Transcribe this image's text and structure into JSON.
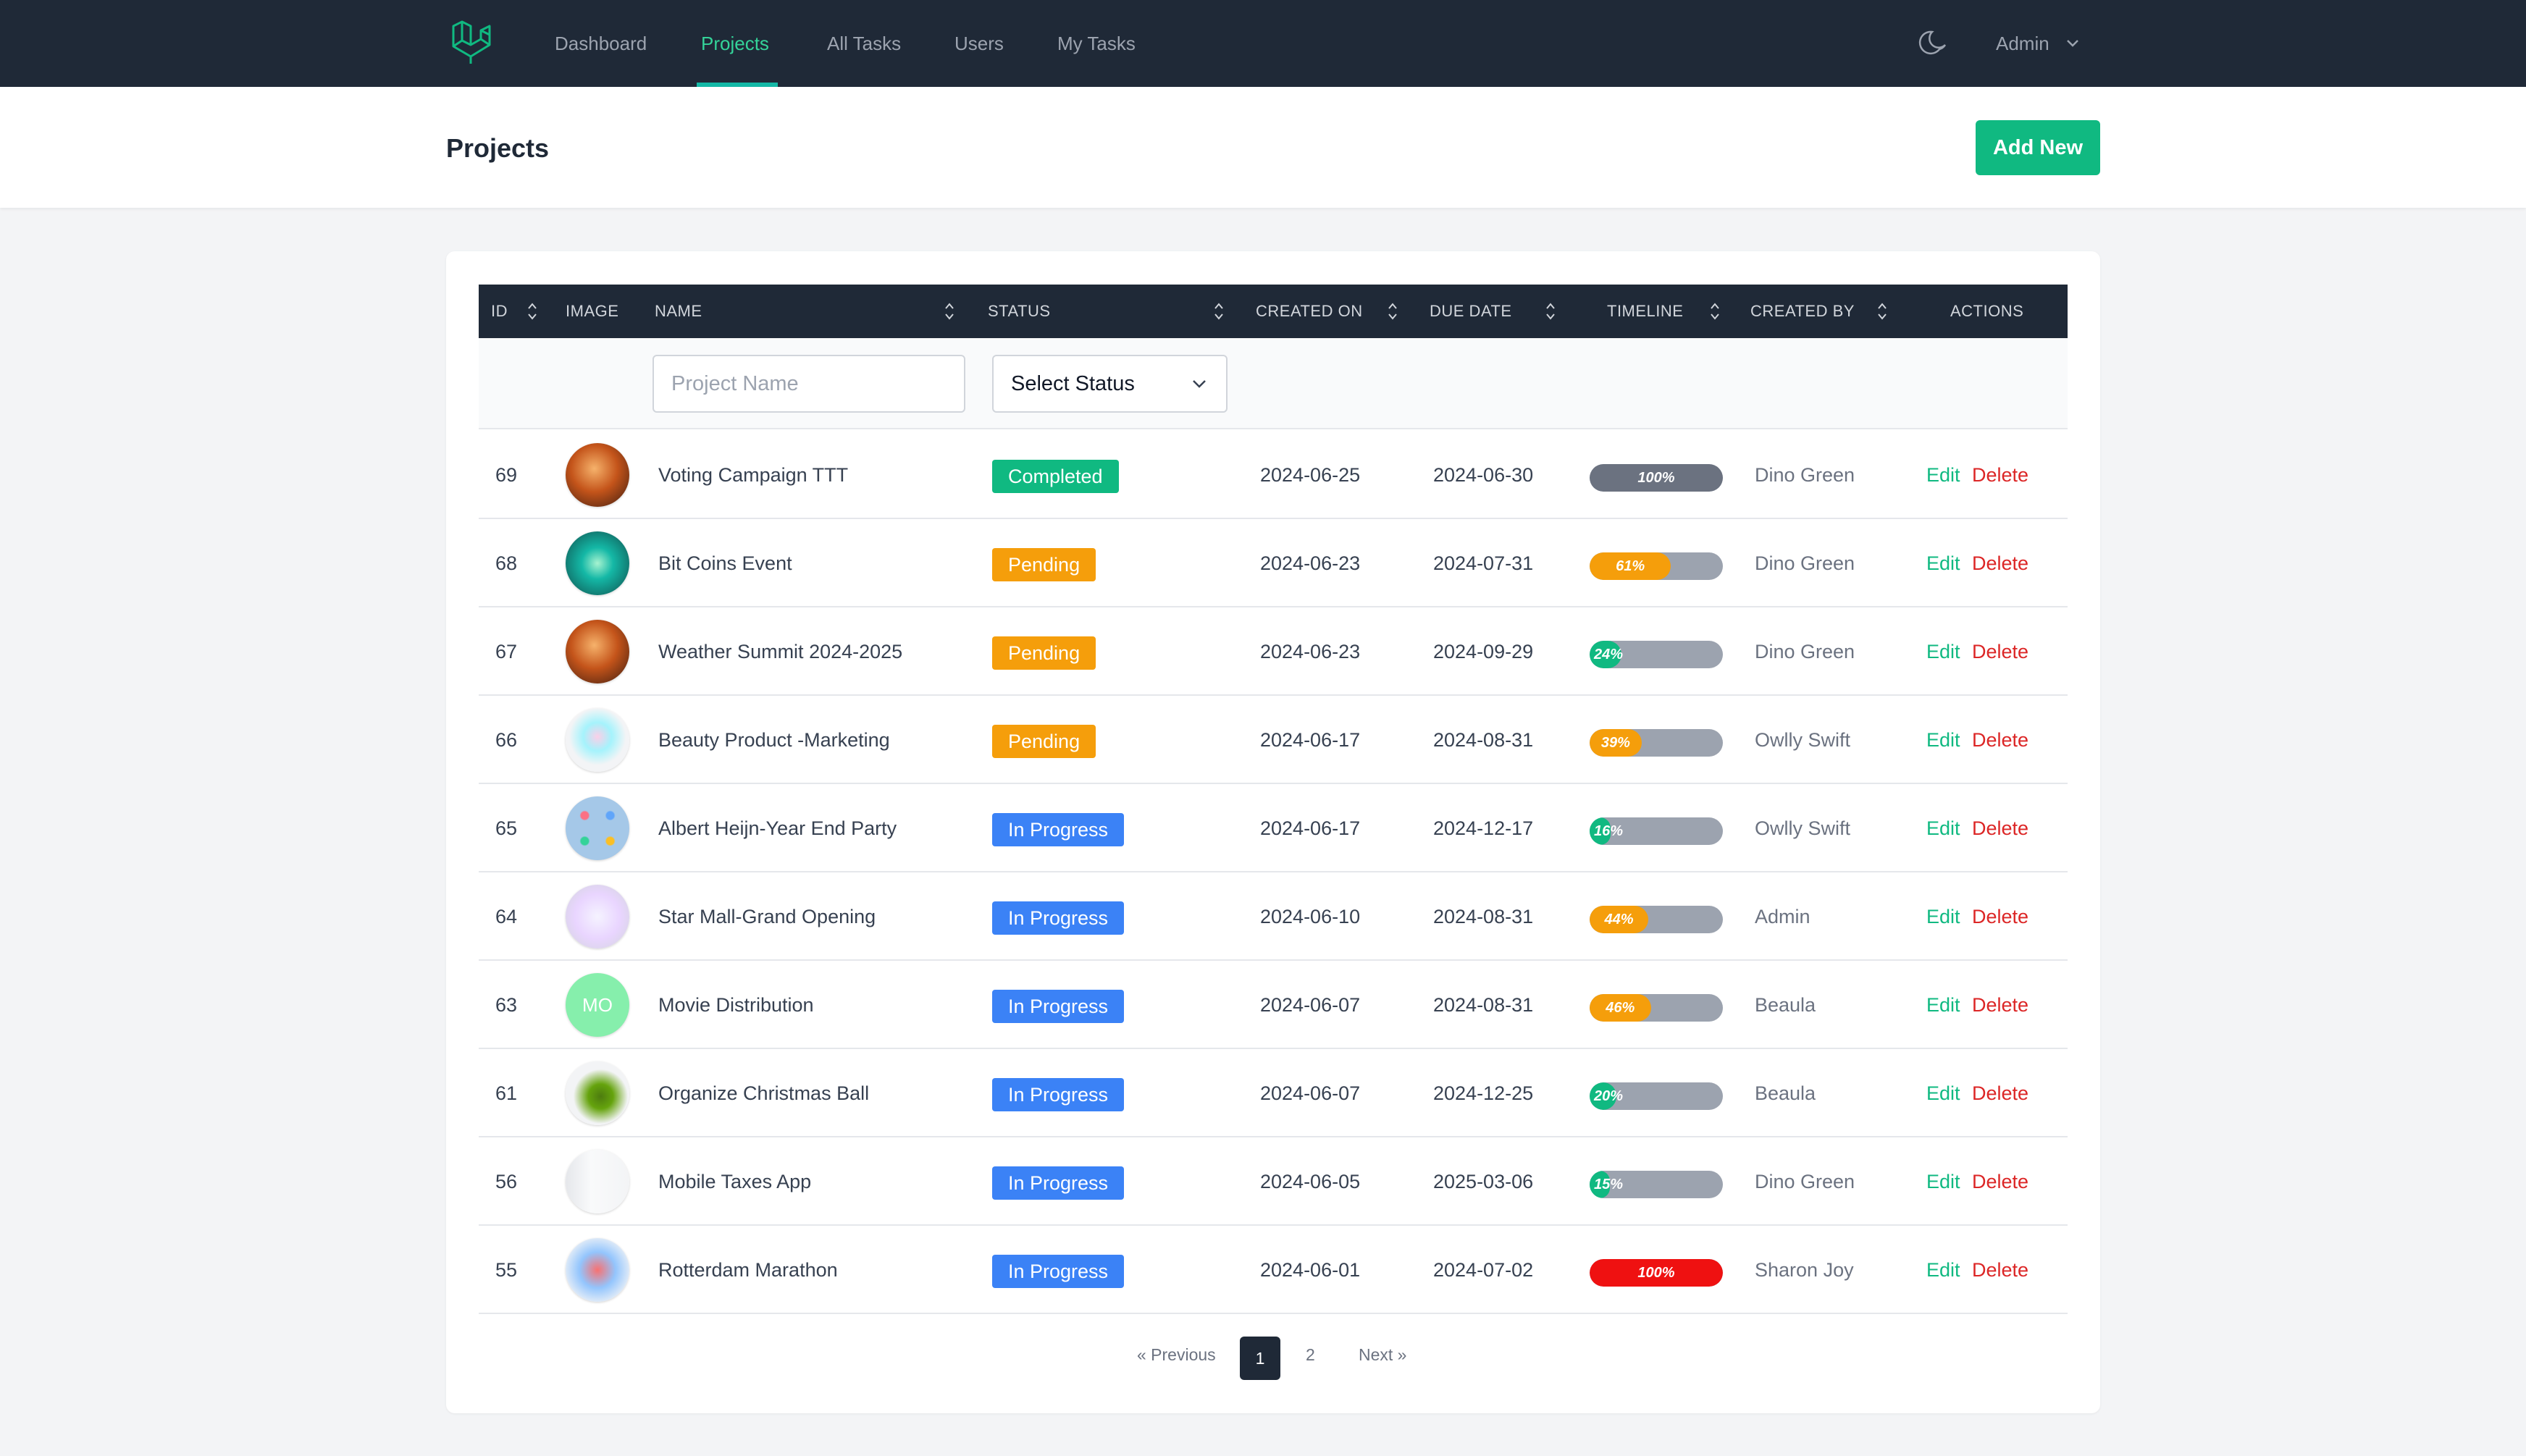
{
  "nav": {
    "items": [
      "Dashboard",
      "Projects",
      "All Tasks",
      "Users",
      "My Tasks"
    ],
    "active": "Projects",
    "user": "Admin",
    "icons": {
      "logo": "laravel-logo-icon",
      "theme": "moon-icon",
      "user_menu": "chevron-down-icon"
    }
  },
  "header": {
    "title": "Projects",
    "add_button": "Add New"
  },
  "table": {
    "columns": [
      "ID",
      "IMAGE",
      "NAME",
      "STATUS",
      "CREATED ON",
      "DUE DATE",
      "TIMELINE",
      "CREATED BY",
      "ACTIONS"
    ],
    "filters": {
      "name_placeholder": "Project Name",
      "status_value": "Select Status"
    },
    "rows": [
      {
        "id": "69",
        "name": "Voting Campaign TTT",
        "status": "Completed",
        "created_on": "2024-06-25",
        "due_date": "2024-06-30",
        "timeline": "100%",
        "created_by": "Dino Green"
      },
      {
        "id": "68",
        "name": "Bit Coins Event",
        "status": "Pending",
        "created_on": "2024-06-23",
        "due_date": "2024-07-31",
        "timeline": "61%",
        "created_by": "Dino Green"
      },
      {
        "id": "67",
        "name": "Weather Summit 2024-2025",
        "status": "Pending",
        "created_on": "2024-06-23",
        "due_date": "2024-09-29",
        "timeline": "24%",
        "created_by": "Dino Green"
      },
      {
        "id": "66",
        "name": "Beauty Product -Marketing",
        "status": "Pending",
        "created_on": "2024-06-17",
        "due_date": "2024-08-31",
        "timeline": "39%",
        "created_by": "Owlly Swift"
      },
      {
        "id": "65",
        "name": "Albert Heijn-Year End Party",
        "status": "In Progress",
        "created_on": "2024-06-17",
        "due_date": "2024-12-17",
        "timeline": "16%",
        "created_by": "Owlly Swift"
      },
      {
        "id": "64",
        "name": "Star Mall-Grand Opening",
        "status": "In Progress",
        "created_on": "2024-06-10",
        "due_date": "2024-08-31",
        "timeline": "44%",
        "created_by": "Admin"
      },
      {
        "id": "63",
        "name": "Movie Distribution",
        "status": "In Progress",
        "created_on": "2024-06-07",
        "due_date": "2024-08-31",
        "timeline": "46%",
        "created_by": "Beaula",
        "avatar_text": "MO"
      },
      {
        "id": "61",
        "name": "Organize Christmas Ball",
        "status": "In Progress",
        "created_on": "2024-06-07",
        "due_date": "2024-12-25",
        "timeline": "20%",
        "created_by": "Beaula"
      },
      {
        "id": "56",
        "name": "Mobile Taxes App",
        "status": "In Progress",
        "created_on": "2024-06-05",
        "due_date": "2025-03-06",
        "timeline": "15%",
        "created_by": "Dino Green"
      },
      {
        "id": "55",
        "name": "Rotterdam Marathon",
        "status": "In Progress",
        "created_on": "2024-06-01",
        "due_date": "2024-07-02",
        "timeline": "100%",
        "created_by": "Sharon Joy"
      }
    ],
    "actions": {
      "edit": "Edit",
      "delete": "Delete"
    }
  },
  "pagination": {
    "previous": "« Previous",
    "pages": [
      "1",
      "2"
    ],
    "current": "1",
    "next": "Next »"
  },
  "colors": {
    "nav_bg": "#1f2937",
    "accent": "#10b981",
    "completed": "#10b981",
    "pending": "#f59e0b",
    "in_progress": "#3b82f6",
    "danger": "#dc2626"
  }
}
